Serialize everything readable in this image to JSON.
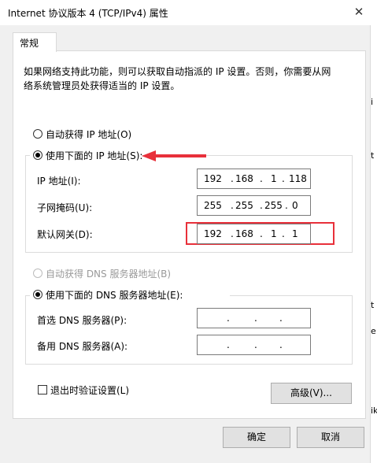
{
  "window": {
    "title": "Internet 协议版本 4 (TCP/IPv4) 属性",
    "close_glyph": "✕"
  },
  "tab": {
    "label": "常规"
  },
  "description": {
    "line1": "如果网络支持此功能，则可以获取自动指派的 IP 设置。否则，你需要从网",
    "line2": "络系统管理员处获得适当的 IP 设置。"
  },
  "ip": {
    "auto_label": "自动获得 IP 地址(O)",
    "manual_label": "使用下面的 IP 地址(S):",
    "manual_selected": true,
    "fields": {
      "address": {
        "label": "IP 地址(I):",
        "octets": [
          "192",
          "168",
          "1",
          "118"
        ]
      },
      "subnet": {
        "label": "子网掩码(U):",
        "octets": [
          "255",
          "255",
          "255",
          "0"
        ]
      },
      "gateway": {
        "label": "默认网关(D):",
        "octets": [
          "192",
          "168",
          "1",
          "1"
        ]
      }
    }
  },
  "dns": {
    "auto_label": "自动获得 DNS 服务器地址(B)",
    "manual_label": "使用下面的 DNS 服务器地址(E):",
    "manual_selected": true,
    "fields": {
      "preferred": {
        "label": "首选 DNS 服务器(P):",
        "octets": [
          "",
          "",
          "",
          ""
        ]
      },
      "alternate": {
        "label": "备用 DNS 服务器(A):",
        "octets": [
          "",
          "",
          "",
          ""
        ]
      }
    }
  },
  "validate": {
    "label": "退出时验证设置(L)",
    "checked": false
  },
  "buttons": {
    "advanced": "高级(V)...",
    "ok": "确定",
    "cancel": "取消"
  },
  "side_strip": {
    "chars": [
      "i",
      "t",
      "t",
      "e",
      "ik"
    ]
  },
  "colors": {
    "annotation_red": "#e8303a",
    "panel_bg": "#ffffff",
    "dialog_bg": "#f0f0f0"
  }
}
